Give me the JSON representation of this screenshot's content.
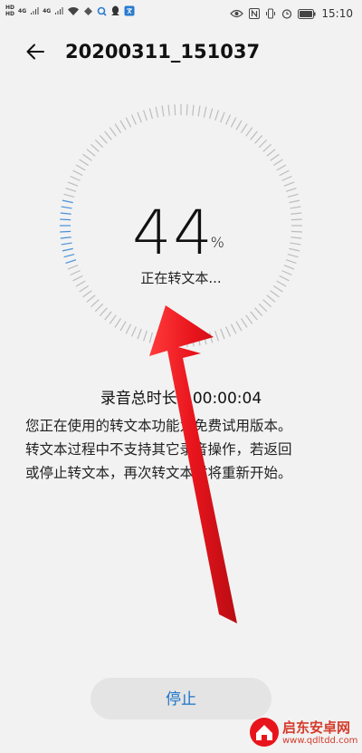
{
  "status_bar": {
    "hd1": "HD",
    "hd2": "HD",
    "net1": "4G",
    "net2": "4G",
    "time": "15:10",
    "battery_icon": "battery-icon",
    "colors": {
      "text": "#333333"
    }
  },
  "header": {
    "back_icon": "arrow-left-icon",
    "title": "20200311_151037"
  },
  "progress": {
    "percent_value": "44",
    "percent_symbol": "%",
    "fraction": 0.44,
    "status": "正在转文本..."
  },
  "recording": {
    "label": "录音总时长：",
    "duration": "00:00:04"
  },
  "notice": {
    "lines": [
      "您正在使用的转文本功能为免费试用版本。",
      "转文本过程中不支持其它录音操作，若返回",
      "或停止转文本，再次转文本时将重新开始。"
    ]
  },
  "actions": {
    "stop_label": "停止"
  },
  "watermark": {
    "name": "启东安卓网",
    "url": "www.qdltdd.com"
  },
  "colors": {
    "accent": "#1a73c9",
    "tick_active": "#4a90d9",
    "tick_inactive": "#bdbdbd",
    "arrow": "#e8141c",
    "background": "#f2f2f2"
  }
}
